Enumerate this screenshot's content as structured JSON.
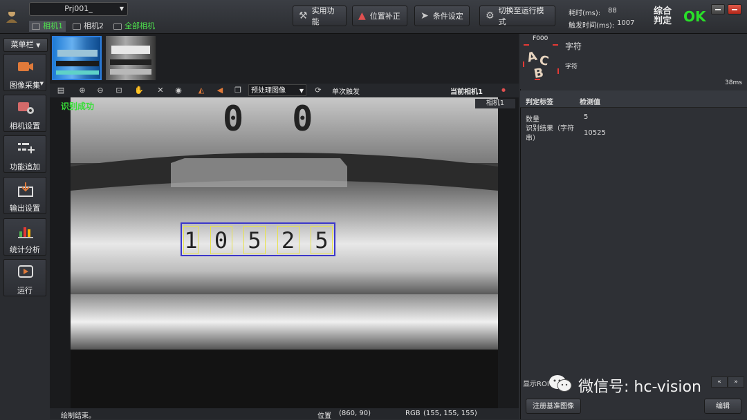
{
  "header": {
    "project": "Prj001_",
    "camera_tabs": [
      "相机1",
      "相机2",
      "全部相机"
    ],
    "buttons": [
      "实用功能",
      "位置补正",
      "条件设定",
      "切换至运行模式"
    ],
    "elapsed_label": "耗时(ms):",
    "elapsed_value": "88",
    "trigger_label": "触发时间(ms):",
    "trigger_value": "1007",
    "judge_label": "综合判定",
    "judge_result": "OK",
    "ok_color": "#29e029"
  },
  "sidebar": {
    "menu": "菜单栏",
    "items": [
      {
        "label": "图像采集",
        "icon": "camera-icon"
      },
      {
        "label": "相机设置",
        "icon": "camera-settings-icon"
      },
      {
        "label": "功能追加",
        "icon": "add-function-icon"
      },
      {
        "label": "输出设置",
        "icon": "output-icon"
      },
      {
        "label": "统计分析",
        "icon": "bar-chart-icon"
      },
      {
        "label": "运行",
        "icon": "play-icon"
      }
    ]
  },
  "toolbar": {
    "image_select": "预处理图像",
    "single_trigger": "单次触发",
    "current_camera": "当前相机1"
  },
  "viewer": {
    "status_text": "识别成功",
    "camera_label": "相机1",
    "top_digits": "0 0",
    "ocr_digits": [
      "1",
      "0",
      "5",
      "2",
      "5"
    ]
  },
  "statusbar": {
    "left": "绘制结束。",
    "position_label": "位置",
    "position_value": "(860, 90)",
    "rgb_label": "RGB",
    "rgb_value": "(155, 155, 155)"
  },
  "right_panel": {
    "tool_id": "F000",
    "tool_name": "字符",
    "tool_sub": "字符",
    "time": "38ms",
    "col_label": "判定标签",
    "col_value": "检测值",
    "rows": [
      {
        "label": "数量",
        "value": "5"
      },
      {
        "label": "识别结果（字符串）",
        "value": "10525"
      }
    ],
    "show_roi": "显示ROI",
    "register_button": "注册基准图像",
    "edit_button": "编辑"
  },
  "watermark": "微信号: hc-vision"
}
